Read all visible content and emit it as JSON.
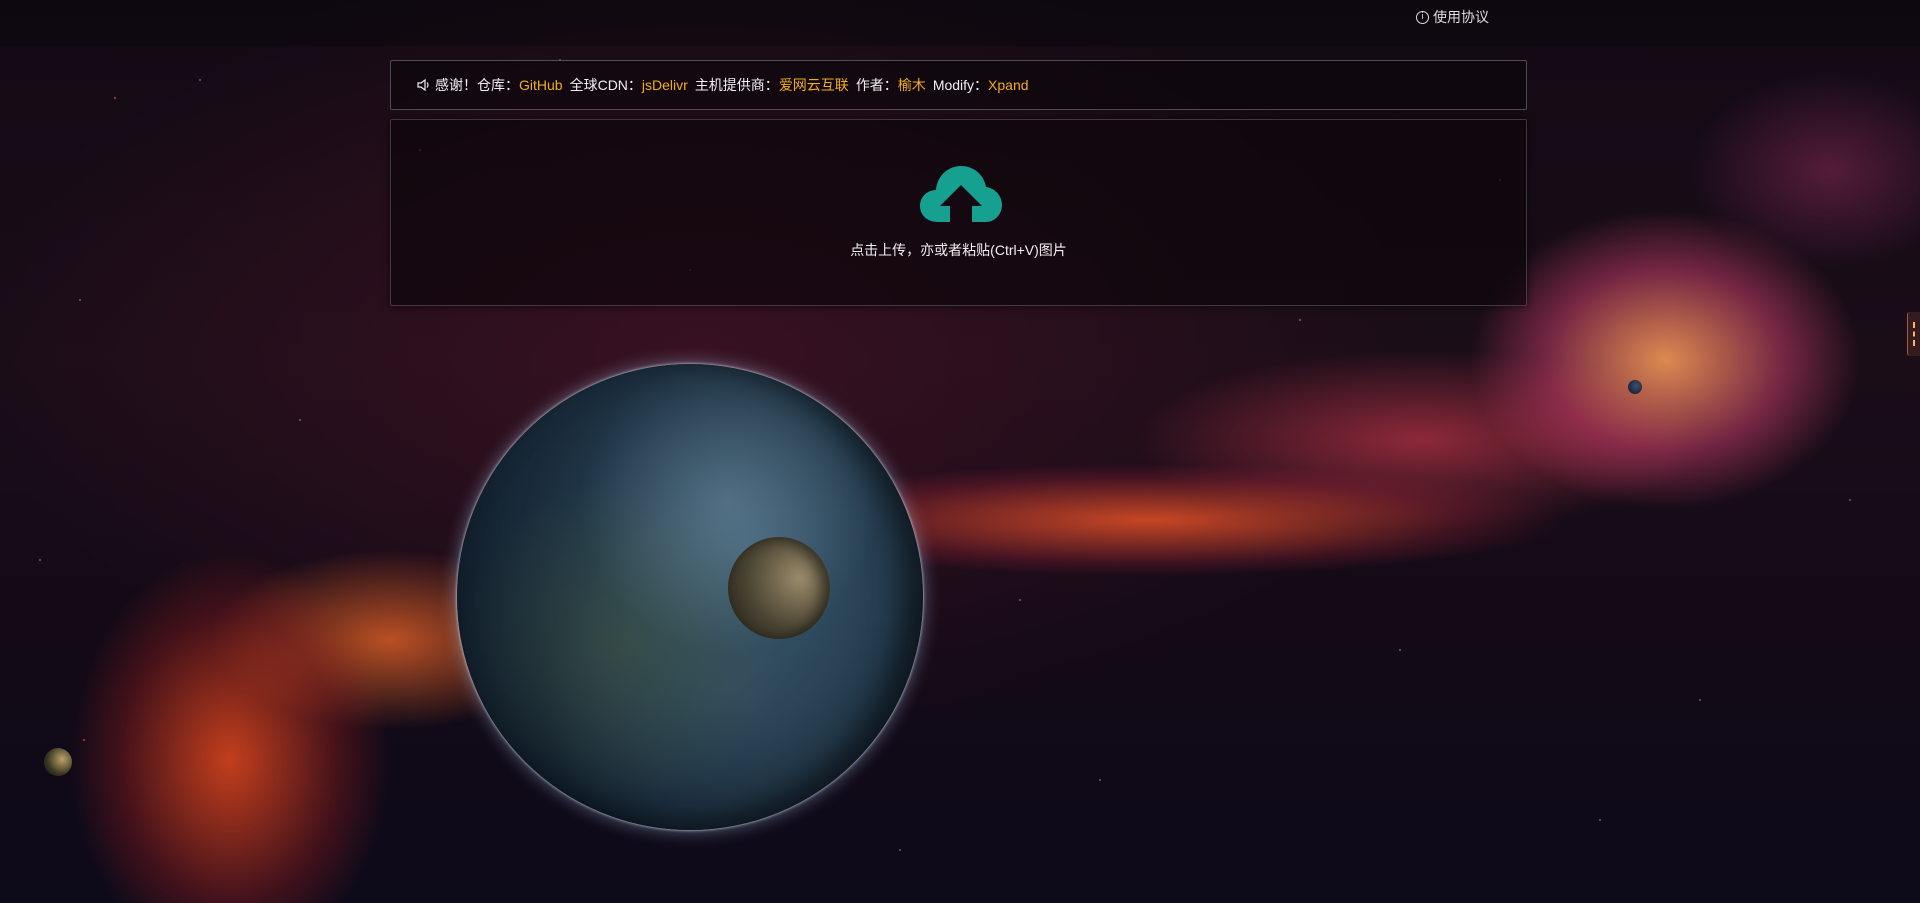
{
  "topbar": {
    "terms_label": "使用协议",
    "terms_icon": "info-icon"
  },
  "notice": {
    "icon": "speaker-icon",
    "thanks": "感谢！",
    "repo_label": "仓库：",
    "repo_link": "GitHub",
    "cdn_label": "全球CDN：",
    "cdn_link": "jsDelivr",
    "host_label": "主机提供商：",
    "host_link": "爱网云互联",
    "author_label": "作者：",
    "author_link": "榆木",
    "modify_label": "Modify：",
    "modify_link": "Xpand",
    "link_color": "#f0ad1e"
  },
  "upload": {
    "icon": "cloud-upload-icon",
    "hint": "点击上传，亦或者粘贴(Ctrl+V)图片",
    "icon_color": "#16a08f"
  }
}
